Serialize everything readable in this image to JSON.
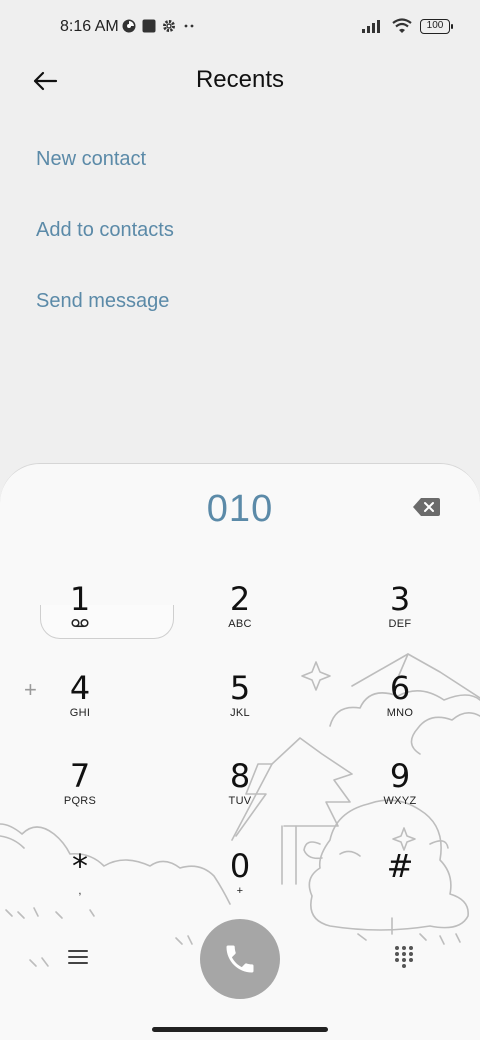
{
  "status": {
    "time": "8:16 AM",
    "battery": "100",
    "icons": [
      "camera-sync-icon",
      "square-icon",
      "settings-gear-icon",
      "more-dots-icon",
      "signal-icon",
      "wifi-icon",
      "battery-icon"
    ]
  },
  "header": {
    "title": "Recents",
    "back_icon": "arrow-left-icon"
  },
  "menu": {
    "items": [
      {
        "label": "New contact"
      },
      {
        "label": "Add to contacts"
      },
      {
        "label": "Send message"
      }
    ]
  },
  "dialpad": {
    "number": "010",
    "keys": [
      {
        "digit": "1",
        "letters": ""
      },
      {
        "digit": "2",
        "letters": "ABC"
      },
      {
        "digit": "3",
        "letters": "DEF"
      },
      {
        "digit": "4",
        "letters": "GHI"
      },
      {
        "digit": "5",
        "letters": "JKL"
      },
      {
        "digit": "6",
        "letters": "MNO"
      },
      {
        "digit": "7",
        "letters": "PQRS"
      },
      {
        "digit": "8",
        "letters": "TUV"
      },
      {
        "digit": "9",
        "letters": "WXYZ"
      },
      {
        "digit": "*",
        "letters": ","
      },
      {
        "digit": "0",
        "letters": "+"
      },
      {
        "digit": "#",
        "letters": ""
      }
    ],
    "side_plus": "+"
  },
  "colors": {
    "accent": "#5b8aa8",
    "call_button": "#a6a6a6",
    "background": "#efefef",
    "sheet": "#f9f9f9"
  }
}
